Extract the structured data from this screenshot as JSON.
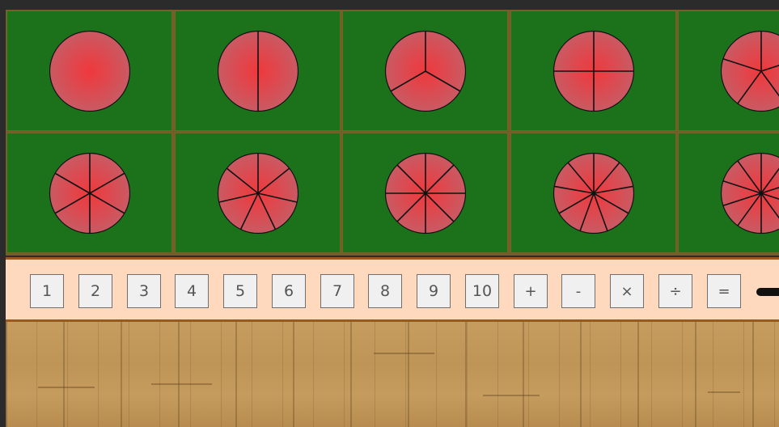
{
  "board": {
    "tiles": [
      {
        "pieces": 1
      },
      {
        "pieces": 2
      },
      {
        "pieces": 3
      },
      {
        "pieces": 4
      },
      {
        "pieces": 5
      },
      {
        "pieces": 6
      },
      {
        "pieces": 7
      },
      {
        "pieces": 8
      },
      {
        "pieces": 9
      },
      {
        "pieces": 10
      }
    ],
    "colors": {
      "felt": "#1c721b",
      "divider": "#7a5a2a",
      "circle_center": "#f0383c",
      "circle_edge": "#c95a63",
      "stroke": "#111111"
    }
  },
  "keypad": {
    "numbers": [
      "1",
      "2",
      "3",
      "4",
      "5",
      "6",
      "7",
      "8",
      "9",
      "10"
    ],
    "operators": [
      "+",
      "-",
      "×",
      "÷",
      "="
    ],
    "colors": {
      "background": "#ffd9be",
      "border": "#a0571f"
    }
  }
}
